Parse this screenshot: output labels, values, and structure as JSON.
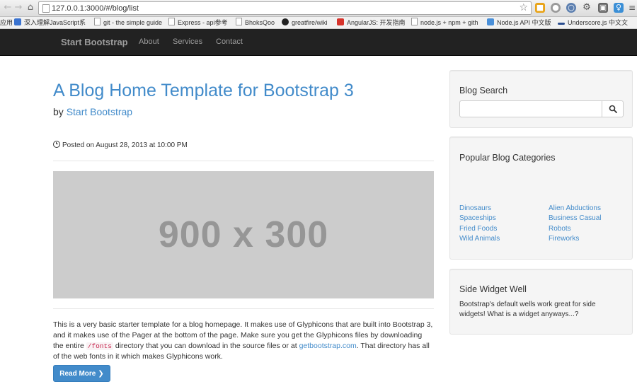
{
  "browser": {
    "url": "127.0.0.1:3000/#/blog/list",
    "bookmarks": [
      {
        "label": "应用"
      },
      {
        "label": "深入理解JavaScript系"
      },
      {
        "label": "git - the simple guide"
      },
      {
        "label": "Express - api参考"
      },
      {
        "label": "BhoksQoo"
      },
      {
        "label": "greatfire/wiki"
      },
      {
        "label": "AngularJS: 开发指南"
      },
      {
        "label": "node.js + npm + gith"
      },
      {
        "label": "Node.js API 中文版"
      },
      {
        "label": "Underscore.js 中文文"
      }
    ]
  },
  "navbar": {
    "brand": "Start Bootstrap",
    "links": [
      {
        "label": "About"
      },
      {
        "label": "Services"
      },
      {
        "label": "Contact"
      }
    ]
  },
  "post": {
    "title": "A Blog Home Template for Bootstrap 3",
    "by_prefix": "by",
    "author": "Start Bootstrap",
    "posted": "Posted on August 28, 2013 at 10:00 PM",
    "image_text": "900 x 300",
    "body_part1": "This is a very basic starter template for a blog homepage. It makes use of Glyphicons that are built into Bootstrap 3, and it makes use of the Pager at the bottom of the page. Make sure you get the Glyphicons files by downloading the entire",
    "body_code": "/fonts",
    "body_part2": "directory that you can download in the source files or at",
    "body_link": "getbootstrap.com",
    "body_part3": ". That directory has all of the web fonts in it which makes Glyphicons work.",
    "read_more": "Read More"
  },
  "sidebar": {
    "search": {
      "title": "Blog Search",
      "value": ""
    },
    "categories": {
      "title": "Popular Blog Categories",
      "left": [
        "Dinosaurs",
        "Spaceships",
        "Fried Foods",
        "Wild Animals"
      ],
      "right": [
        "Alien Abductions",
        "Business Casual",
        "Robots",
        "Fireworks"
      ]
    },
    "widget": {
      "title": "Side Widget Well",
      "text": "Bootstrap's default wells work great for side widgets! What is a widget anyways...?"
    }
  },
  "colors": {
    "primary": "#428bca",
    "navbar": "#222222",
    "placeholder": "#cccccc"
  }
}
